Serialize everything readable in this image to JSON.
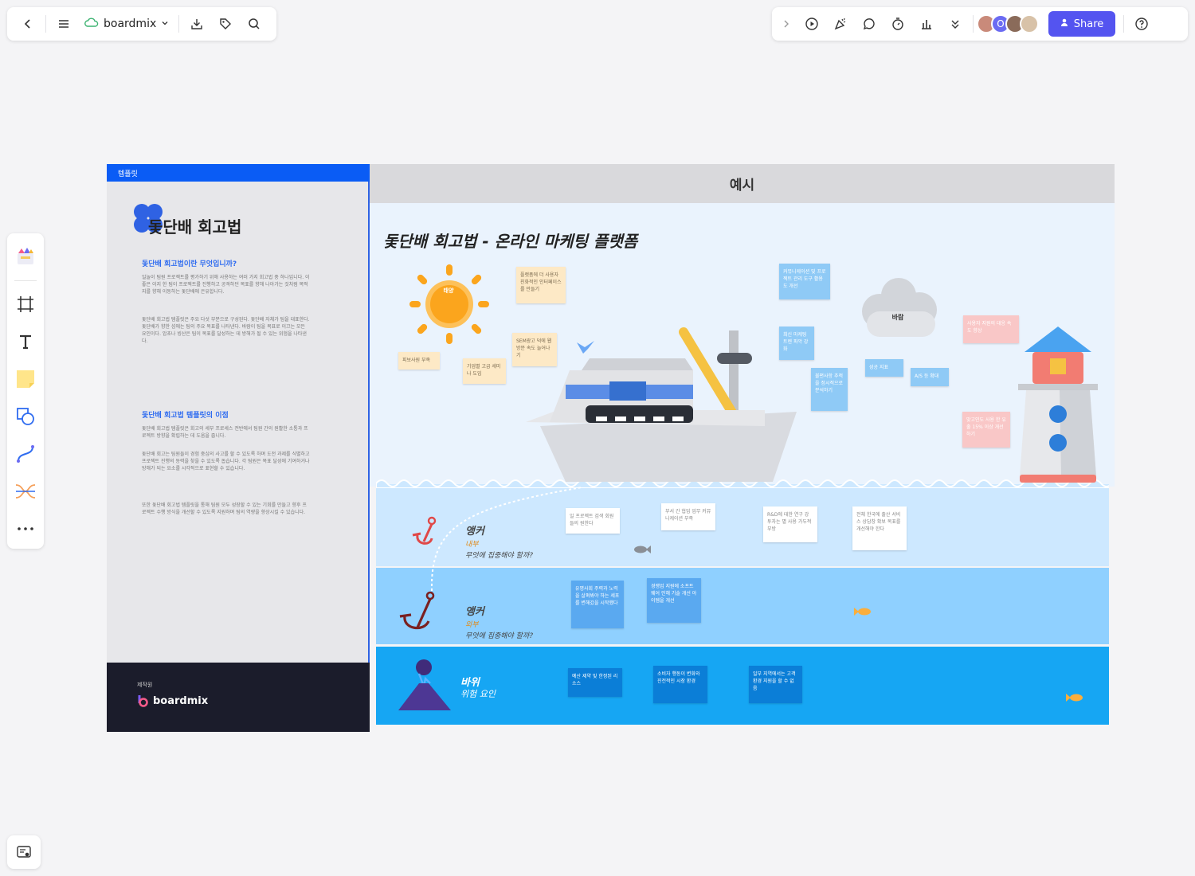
{
  "toolbar_left": {
    "brand_label": "boardmix"
  },
  "toolbar_right": {
    "avatar_initial": "O",
    "share_label": "Share"
  },
  "template": {
    "tag": "템플릿",
    "title": "돛단배 회고법",
    "section1_heading": "돛단배 회고법이란 무엇입니까?",
    "section1_p1": "일놀이 팀원 프로젝트를 평가하기 위해 사용하는 여러 가지 회고법 중 하나입니다. 이좋은 이지 한 팀이 프로젝트를 진행하고 공격하던 목표를 향해 나아가는 것처럼 목적지를 향해 이동하는 돛단배에 은유합니다.",
    "section1_p2": "돛단배 회고법 템플릿은 주요 다섯 부분으로 구성된다. 돛단배 자체가 팀을 대표한다. 돛단배가 향한 섬에는 팀의 주요 목표를 나타낸다. 바람이 팀을 목표로 이끄는 모든 요인이다. 암초나 빙산은 팀이 목표를 달성하는 데 방해가 될 수 있는 위험을 나타낸다.",
    "section2_heading": "돛단배 회고법 템플릿의 이점",
    "section2_p1": "돛단배 회고법 템플릿은 회고의 세부 프로세스 전반에서 팀원 간의 원활한 소통과 프로젝트 방향을 확립하는 데 도움을 줍니다.",
    "section2_p2": "돛단배 회고는 팀원들이 경험 중심의 사고를 할 수 있도록 하며 도전 과제를 식별하고 프로젝트 진행의 동력을 찾을 수 있도록 돕습니다. 각 팀원은 목표 달성에 기여하거나 방해가 되는 요소를 시각적으로 표현할 수 있습니다.",
    "section2_p3": "또한 돛단배 회고법 템플릿을 통해 팀원 모두 성장할 수 있는 기회를 만들고 향후 프로젝트 수행 방식을 개선할 수 있도록 지원하며 팀의 역량을 향상시킬 수 있습니다.",
    "footer_small": "제작원",
    "footer_brand": "boardmix"
  },
  "example": {
    "header": "예시",
    "title": "돛단배 회고법 - 온라인 마케팅 플랫폼",
    "sun_label": "태양",
    "cloud_label": "바람",
    "anchor1_title": "앵커",
    "anchor1_tag": "내부",
    "anchor1_question": "무엇에 집중해야 할까?",
    "anchor2_title": "앵커",
    "anchor2_tag": "외부",
    "anchor2_question": "무엇에 집중해야 할까?",
    "rock_title": "바위",
    "rock_tag": "위험 요인",
    "notes": [
      {
        "text": "플랫폼에 더 사용자 친화적인 인터페이스를 만들기",
        "color": "yellow"
      },
      {
        "text": "피보사원 부족",
        "color": "yellow"
      },
      {
        "text": "SEM광고 덕에 웹 방문 속도 늘어나기",
        "color": "yellow"
      },
      {
        "text": "기업별 고급 세미나 도입",
        "color": "yellow"
      },
      {
        "text": "커뮤니케이션 및 프로젝트 관리 도구 활용도 개선",
        "color": "blue"
      },
      {
        "text": "최신 마케팅 트렌 파악 강화",
        "color": "blue"
      },
      {
        "text": "불편사항 추적을 정시적으로 분석하기",
        "color": "blue"
      },
      {
        "text": "성공 지표",
        "color": "blue"
      },
      {
        "text": "A/S 등 확대",
        "color": "blue"
      },
      {
        "text": "사용자 지원의 대응 속도 향상",
        "color": "pink"
      },
      {
        "text": "맞고인도 사용 한 유출 15% 이상 개선하기",
        "color": "pink"
      },
      {
        "text": "일 프로젝트 검색 회원들의 원한다",
        "color": "white"
      },
      {
        "text": "부서 간 협업 업무 커뮤니케이션 부족",
        "color": "white"
      },
      {
        "text": "R&D에 대한 연구 강 투자는 별 사용 가두적 부방",
        "color": "white"
      },
      {
        "text": "전체 한국에 출산 서비스 상담창 확보 목표를 개선해야 한다",
        "color": "white"
      },
      {
        "text": "유명사회 주력과 노력을 살펴봐야 하는 세포를 변해갔을 시작했다",
        "color": "mid"
      },
      {
        "text": "경쟁업 지원에 소프트웨어 인해 기술 개선 아이템을 개선",
        "color": "mid"
      },
      {
        "text": "예산 제약 및 한정된 리소스",
        "color": "dark"
      },
      {
        "text": "소비자 행동이 변화와 진전적인 시장 환경",
        "color": "dark"
      },
      {
        "text": "일부 지역에서는 고객 환경 지원을 할 수 없음",
        "color": "dark"
      }
    ]
  },
  "colors": {
    "accent": "#5454f0",
    "template_tag": "#0a5cf5",
    "footer_bg": "#1b1c2b",
    "sky": "#eaf3fd",
    "water1": "#cde8ff",
    "water2": "#8fd0ff",
    "water3": "#16a6f3"
  },
  "icons": [
    "back-icon",
    "menu-icon",
    "cloud-icon",
    "chevron-down-icon",
    "download-icon",
    "tag-icon",
    "search-icon",
    "chevron-right-icon",
    "play-icon",
    "celebrate-icon",
    "comment-icon",
    "timer-icon",
    "vote-icon",
    "more-chevron-icon",
    "user-add-icon",
    "help-icon"
  ]
}
